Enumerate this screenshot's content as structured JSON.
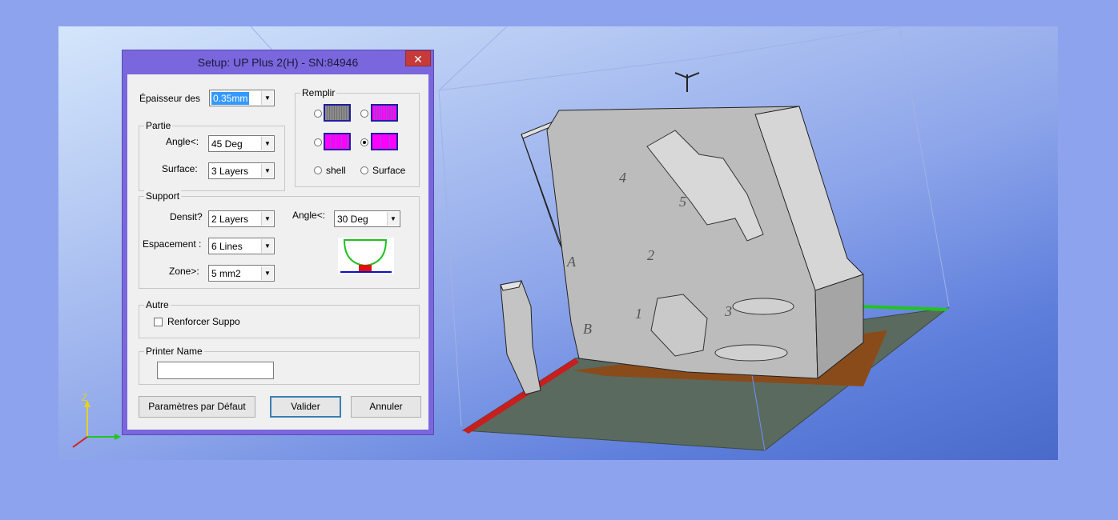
{
  "dialog": {
    "title": "Setup: UP Plus 2(H) - SN:84946",
    "close_glyph": "✕",
    "thickness": {
      "label": "Épaisseur des",
      "value": "0.35mm"
    },
    "partie": {
      "legend": "Partie",
      "angle": {
        "label": "Angle<:",
        "value": "45 Deg"
      },
      "surface": {
        "label": "Surface:",
        "value": "3 Layers"
      }
    },
    "remplir": {
      "legend": "Remplir",
      "shell_label": "shell",
      "surface_label": "Surface",
      "selected_option": 4
    },
    "support": {
      "legend": "Support",
      "density": {
        "label": "Densit?",
        "value": "2 Layers"
      },
      "spacing": {
        "label": "Espacement :",
        "value": "6 Lines"
      },
      "zone": {
        "label": "Zone>:",
        "value": "5 mm2"
      },
      "angle": {
        "label": "Angle<:",
        "value": "30 Deg"
      }
    },
    "autre": {
      "legend": "Autre",
      "reinforce": {
        "label": "Renforcer Suppo",
        "checked": false
      }
    },
    "printer": {
      "legend": "Printer Name",
      "value": ""
    },
    "buttons": {
      "defaults": "Paramètres par Défaut",
      "ok": "Valider",
      "cancel": "Annuler"
    }
  },
  "viewport": {
    "axis_z_label": "Z",
    "part_labels": [
      "4",
      "5",
      "A",
      "2",
      "1",
      "3",
      "B"
    ]
  },
  "colors": {
    "dialog_frame": "#7a66dd",
    "close_button": "#c73a3a",
    "fill_magenta": "#ff00ff",
    "fill_gray": "#8c8c8c",
    "platform": "#5a6a5e"
  },
  "icons": [
    "close-icon",
    "chevron-down-icon",
    "support-shape-icon",
    "axis-gizmo-icon"
  ]
}
